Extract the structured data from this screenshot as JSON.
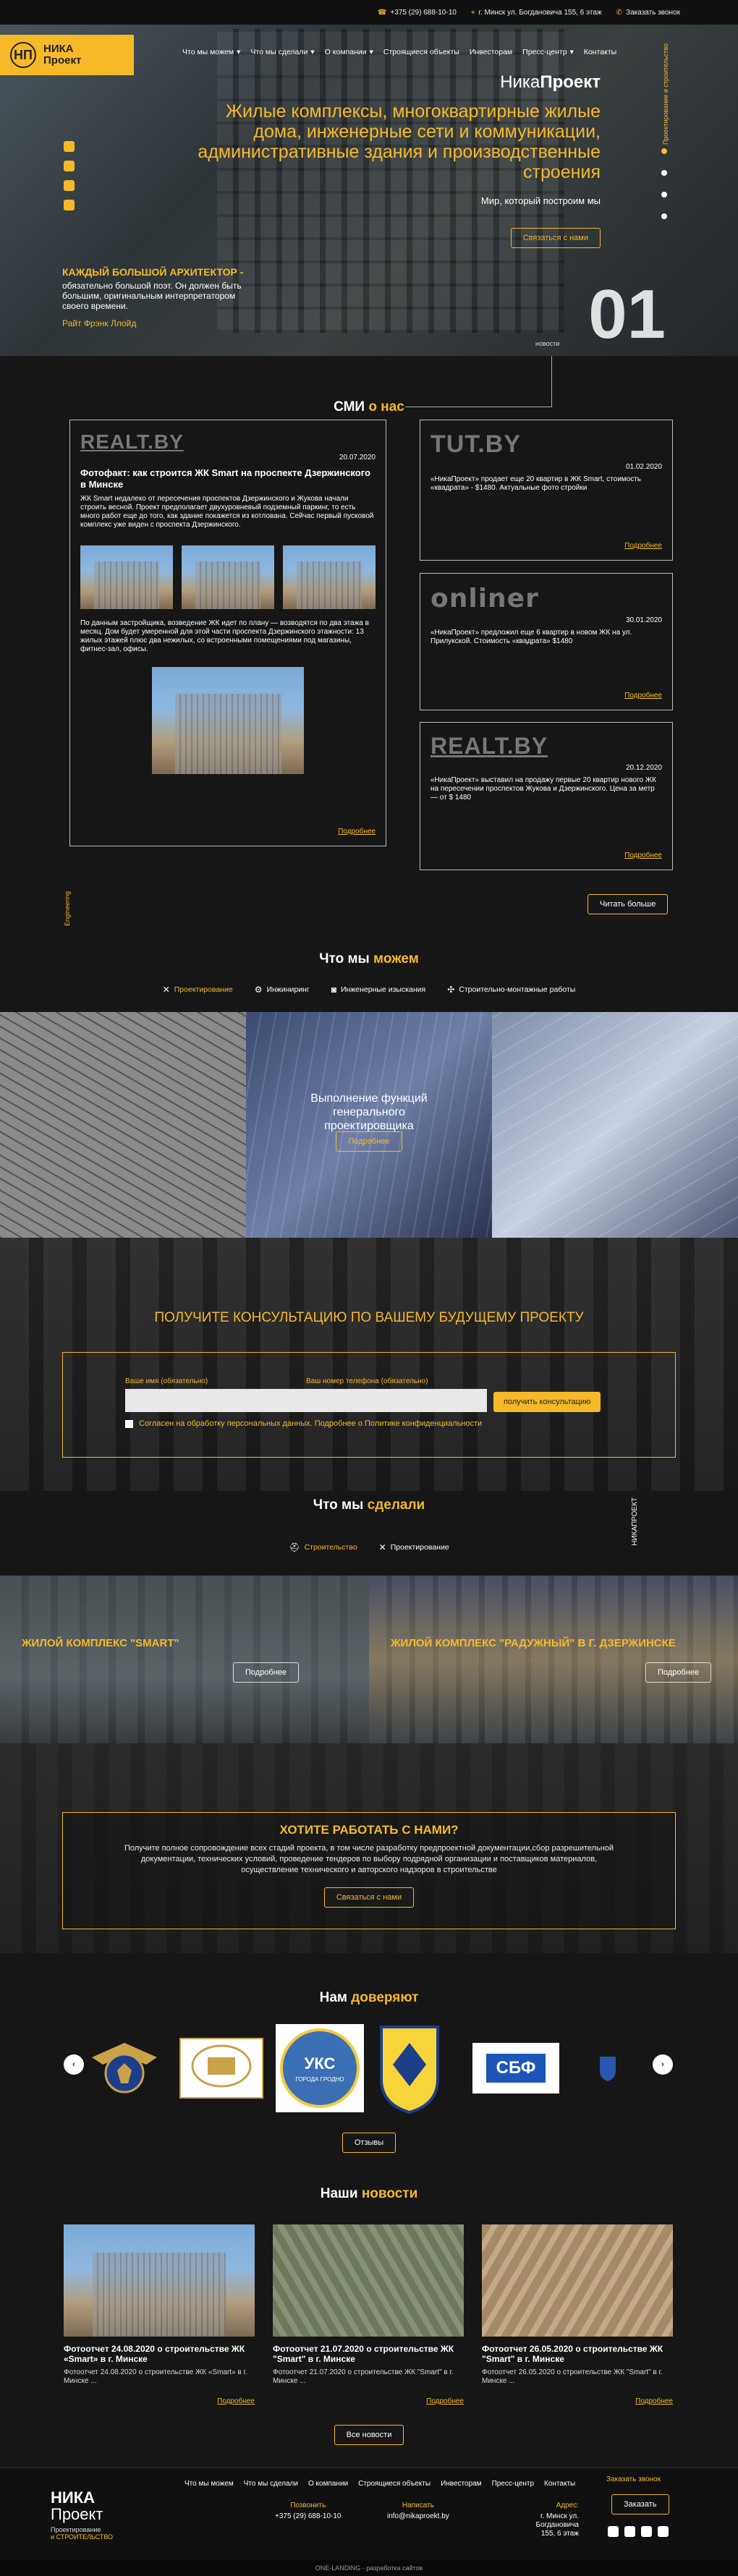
{
  "topbar": {
    "phone": "+375 (29) 688-10-10",
    "address": "г. Минск ул. Богдановича 155, 6 этаж",
    "callback": "Заказать звонок"
  },
  "logo": {
    "mark": "НП",
    "line1": "НИКА",
    "line2": "Проект"
  },
  "nav": [
    "Что мы можем",
    "Что мы сделали",
    "О компании",
    "Строящиеся объекты",
    "Инвесторам",
    "Пресс-центр",
    "Контакты"
  ],
  "hero": {
    "brand_a": "Ника",
    "brand_b": "Проект",
    "tagline": "Жилые комплексы, многоквартирные жилые дома, инженерные сети и коммуникации, административные здания и производственные строения",
    "sub": "Мир, который построим мы",
    "cta": "Связаться с нами",
    "side": "Проектирование и строительство",
    "quote1": "КАЖДЫЙ БОЛЬШОЙ АРХИТЕКТОР -",
    "quote2": "обязательно большой поэт. Он должен быть большим, оригинальным интерпретатором своего времени.",
    "quote3": "Райт Фрэнк Ллойд",
    "number": "01",
    "news_label": "новости"
  },
  "smi": {
    "title_a": "СМИ",
    "title_b": "о нас",
    "main": {
      "source": "REALT.BY",
      "date": "20.07.2020",
      "title": "Фотофакт: как строится ЖК Smart на проспекте Дзержинского в Минске",
      "text1": "ЖК Smart недалеко от пересечения проспектов Дзержинского и Жукова начали строить весной. Проект предполагает двухуровневый подземный паркинг, то есть много работ еще до того, как здание покажется из котлована. Сейчас первый пусковой комплекс уже виден с проспекта Дзержинского.",
      "text2": "По данным застройщика, возведение ЖК идет по плану — возводятся по два этажа в месяц. Дом будет умеренной для этой части проспекта Дзержинского этажности: 13 жилых этажей плюс два нежилых, со встроенными помещениями под магазины, фитнес-зал, офисы.",
      "more": "Подробнее"
    },
    "items": [
      {
        "source": "TUT.BY",
        "date": "01.02.2020",
        "text": "«НикаПроект» продает еще 20 квартир в ЖК Smart, стоимость «квадрата» - $1480. Актуальные фото стройки",
        "more": "Подробнее"
      },
      {
        "source": "onliner",
        "date": "30.01.2020",
        "text": "«НикаПроект» предложил еще 6 квартир в новом ЖК на ул. Прилукской. Стоимость «квадрата» $1480",
        "more": "Подробнее"
      },
      {
        "source": "REALT.BY",
        "date": "20.12.2020",
        "text": "«НикаПроект» выставил на продажу первые 20 квартир нового ЖК на пересечении проспектов Жукова и Дзержинского. Цена за метр — от $ 1480",
        "more": "Подробнее"
      }
    ],
    "read_more": "Читать больше",
    "side": "Engineering"
  },
  "services": {
    "title_a": "Что мы",
    "title_b": "можем",
    "tabs": [
      "Проектирование",
      "Инжиниринг",
      "Инженерные изыскания",
      "Строительно-монтажные работы"
    ],
    "center_title": "Выполнение функций генерального проектировщика",
    "center_btn": "Подробнее"
  },
  "consult": {
    "title": "ПОЛУЧИТЕ КОНСУЛЬТАЦИЮ ПО ВАШЕМУ БУДУЩЕМУ ПРОЕКТУ",
    "name_label": "Ваше имя (обязательно)",
    "phone_label": "Ваш номер телефона (обязательно)",
    "submit": "получить консультацию",
    "agree": "Согласен на обработку персональных данных. Подробнее о Политике конфиденциальности"
  },
  "done": {
    "title_a": "Что мы",
    "title_b": "сделали",
    "tabs": [
      "Строительство",
      "Проектирование"
    ],
    "side": "НИКАПРОЕКТ",
    "projects": [
      {
        "title": "ЖИЛОЙ КОМПЛЕКС \"SMART\"",
        "btn": "Подробнее"
      },
      {
        "title": "ЖИЛОЙ КОМПЛЕКС \"РАДУЖНЫЙ\" В Г. ДЗЕРЖИНСКЕ",
        "btn": "Подробнее"
      }
    ]
  },
  "hire": {
    "title": "ХОТИТЕ РАБОТАТЬ С НАМИ?",
    "text": "Получите полное сопровождение всех стадий проекта, в том числе разработку предпроектной документации,сбор разрешительной документации, технических условий, проведение тендеров по выбору подрядной организации и поставщиков материалов, осуществление технического и авторского надзоров в строительстве",
    "btn": "Связаться с нами"
  },
  "trust": {
    "title_a": "Нам",
    "title_b": "доверяют",
    "logo_text": [
      "СБФ",
      "УКС",
      "ГОРОДА ГРОДНО"
    ],
    "btn": "Отзывы"
  },
  "news": {
    "title_a": "Наши",
    "title_b": "новости",
    "items": [
      {
        "title": "Фотоотчет 24.08.2020 о строительстве ЖК «Smart» в г. Минске",
        "desc": "Фотоотчет 24.08.2020 о строительстве ЖК «Smart» в г. Минске ...",
        "more": "Подробнее"
      },
      {
        "title": "Фотоотчет 21.07.2020 о строительстве ЖК \"Smart\" в г. Минске",
        "desc": "Фотоотчет 21.07.2020 о строительстве ЖК \"Smart\" в г. Минске ...",
        "more": "Подробнее"
      },
      {
        "title": "Фотоотчет 26.05.2020 о строительстве ЖК \"Smart\" в г. Минске",
        "desc": "Фотоотчет 26.05.2020 о строительстве ЖК \"Smart\" в г. Минске ...",
        "more": "Подробнее"
      }
    ],
    "all": "Все новости"
  },
  "footer": {
    "logo1": "НИКА",
    "logo2": "Проект",
    "sub1": "Проектирование",
    "sub2": "и СТРОИТЕЛЬСТВО",
    "nav": [
      "Что мы можем",
      "Что мы сделали",
      "О компании",
      "Строящиеся объекты",
      "Инвесторам",
      "Пресс-центр",
      "Контакты"
    ],
    "call_lbl": "Позвонить",
    "call": "+375 (29) 688-10-10",
    "mail_lbl": "Написать",
    "mail": "info@nikaproekt.by",
    "addr_lbl": "Адрес:",
    "addr": "г. Минск ул. Богдановича 155, 6 этаж",
    "callback": "Заказать звонок",
    "order": "Заказать",
    "copy": "ONE-LANDING - разработка сайтов"
  }
}
